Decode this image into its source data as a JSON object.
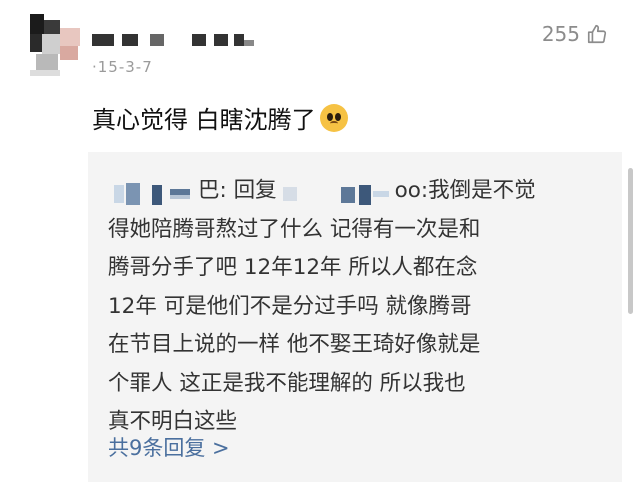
{
  "comment": {
    "timestamp": "·15-3-7",
    "likes": "255",
    "text": "真心觉得 白瞎沈腾了",
    "emoji": "pleading-face-icon"
  },
  "reply": {
    "author_suffix": "巴: 回复",
    "reply_to_suffix": "oo:",
    "lines": [
      "我倒是不觉",
      "得她陪腾哥熬过了什么  记得有一次是和",
      "腾哥分手了吧  12年12年  所以人都在念",
      "12年  可是他们不是分过手吗  就像腾哥",
      "在节目上说的一样  他不娶王琦好像就是",
      "个罪人  这正是我不能理解的  所以我也",
      "真不明白这些"
    ],
    "show_more": "共9条回复 >"
  },
  "colors": {
    "link": "#4a6f9e",
    "reply_bg": "#f4f4f4",
    "muted": "#9a9a9a"
  }
}
